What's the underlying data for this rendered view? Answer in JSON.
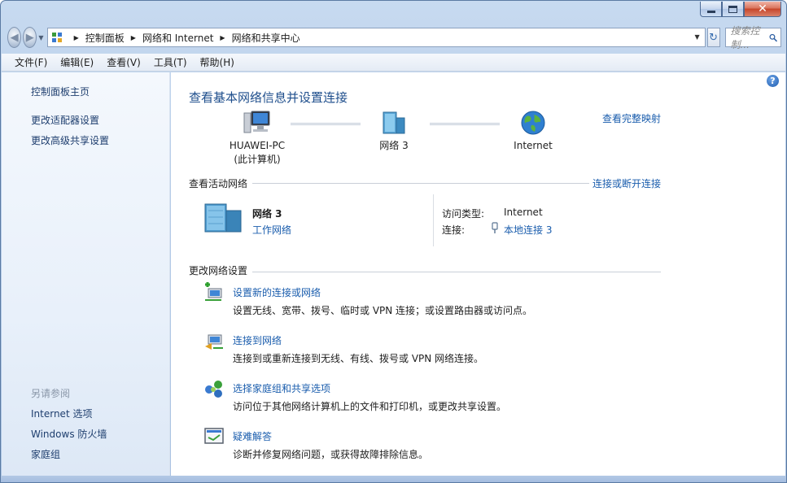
{
  "window": {
    "caption": {
      "minimize": "",
      "maximize": "",
      "close": "✕"
    }
  },
  "address": {
    "breadcrumbs": [
      "控制面板",
      "网络和 Internet",
      "网络和共享中心"
    ],
    "search_placeholder": "搜索控制..."
  },
  "menu": [
    "文件(F)",
    "编辑(E)",
    "查看(V)",
    "工具(T)",
    "帮助(H)"
  ],
  "sidebar": {
    "links": [
      "控制面板主页",
      "更改适配器设置",
      "更改高级共享设置"
    ],
    "see_also_header": "另请参阅",
    "see_also": [
      "Internet 选项",
      "Windows 防火墙",
      "家庭组"
    ]
  },
  "main": {
    "title": "查看基本网络信息并设置连接",
    "full_map_link": "查看完整映射",
    "map": {
      "computer_name": "HUAWEI-PC",
      "computer_sub": "(此计算机)",
      "network_name": "网络  3",
      "internet": "Internet"
    },
    "active": {
      "header": "查看活动网络",
      "connect_link": "连接或断开连接",
      "network_name": "网络  3",
      "network_type": "工作网络",
      "access_label": "访问类型:",
      "access_value": "Internet",
      "connection_label": "连接:",
      "connection_value": "本地连接 3"
    },
    "change": {
      "header": "更改网络设置",
      "tasks": [
        {
          "title": "设置新的连接或网络",
          "desc": "设置无线、宽带、拨号、临时或 VPN 连接；或设置路由器或访问点。"
        },
        {
          "title": "连接到网络",
          "desc": "连接到或重新连接到无线、有线、拨号或 VPN 网络连接。"
        },
        {
          "title": "选择家庭组和共享选项",
          "desc": "访问位于其他网络计算机上的文件和打印机，或更改共享设置。"
        },
        {
          "title": "疑难解答",
          "desc": "诊断并修复网络问题，或获得故障排除信息。"
        }
      ]
    }
  }
}
